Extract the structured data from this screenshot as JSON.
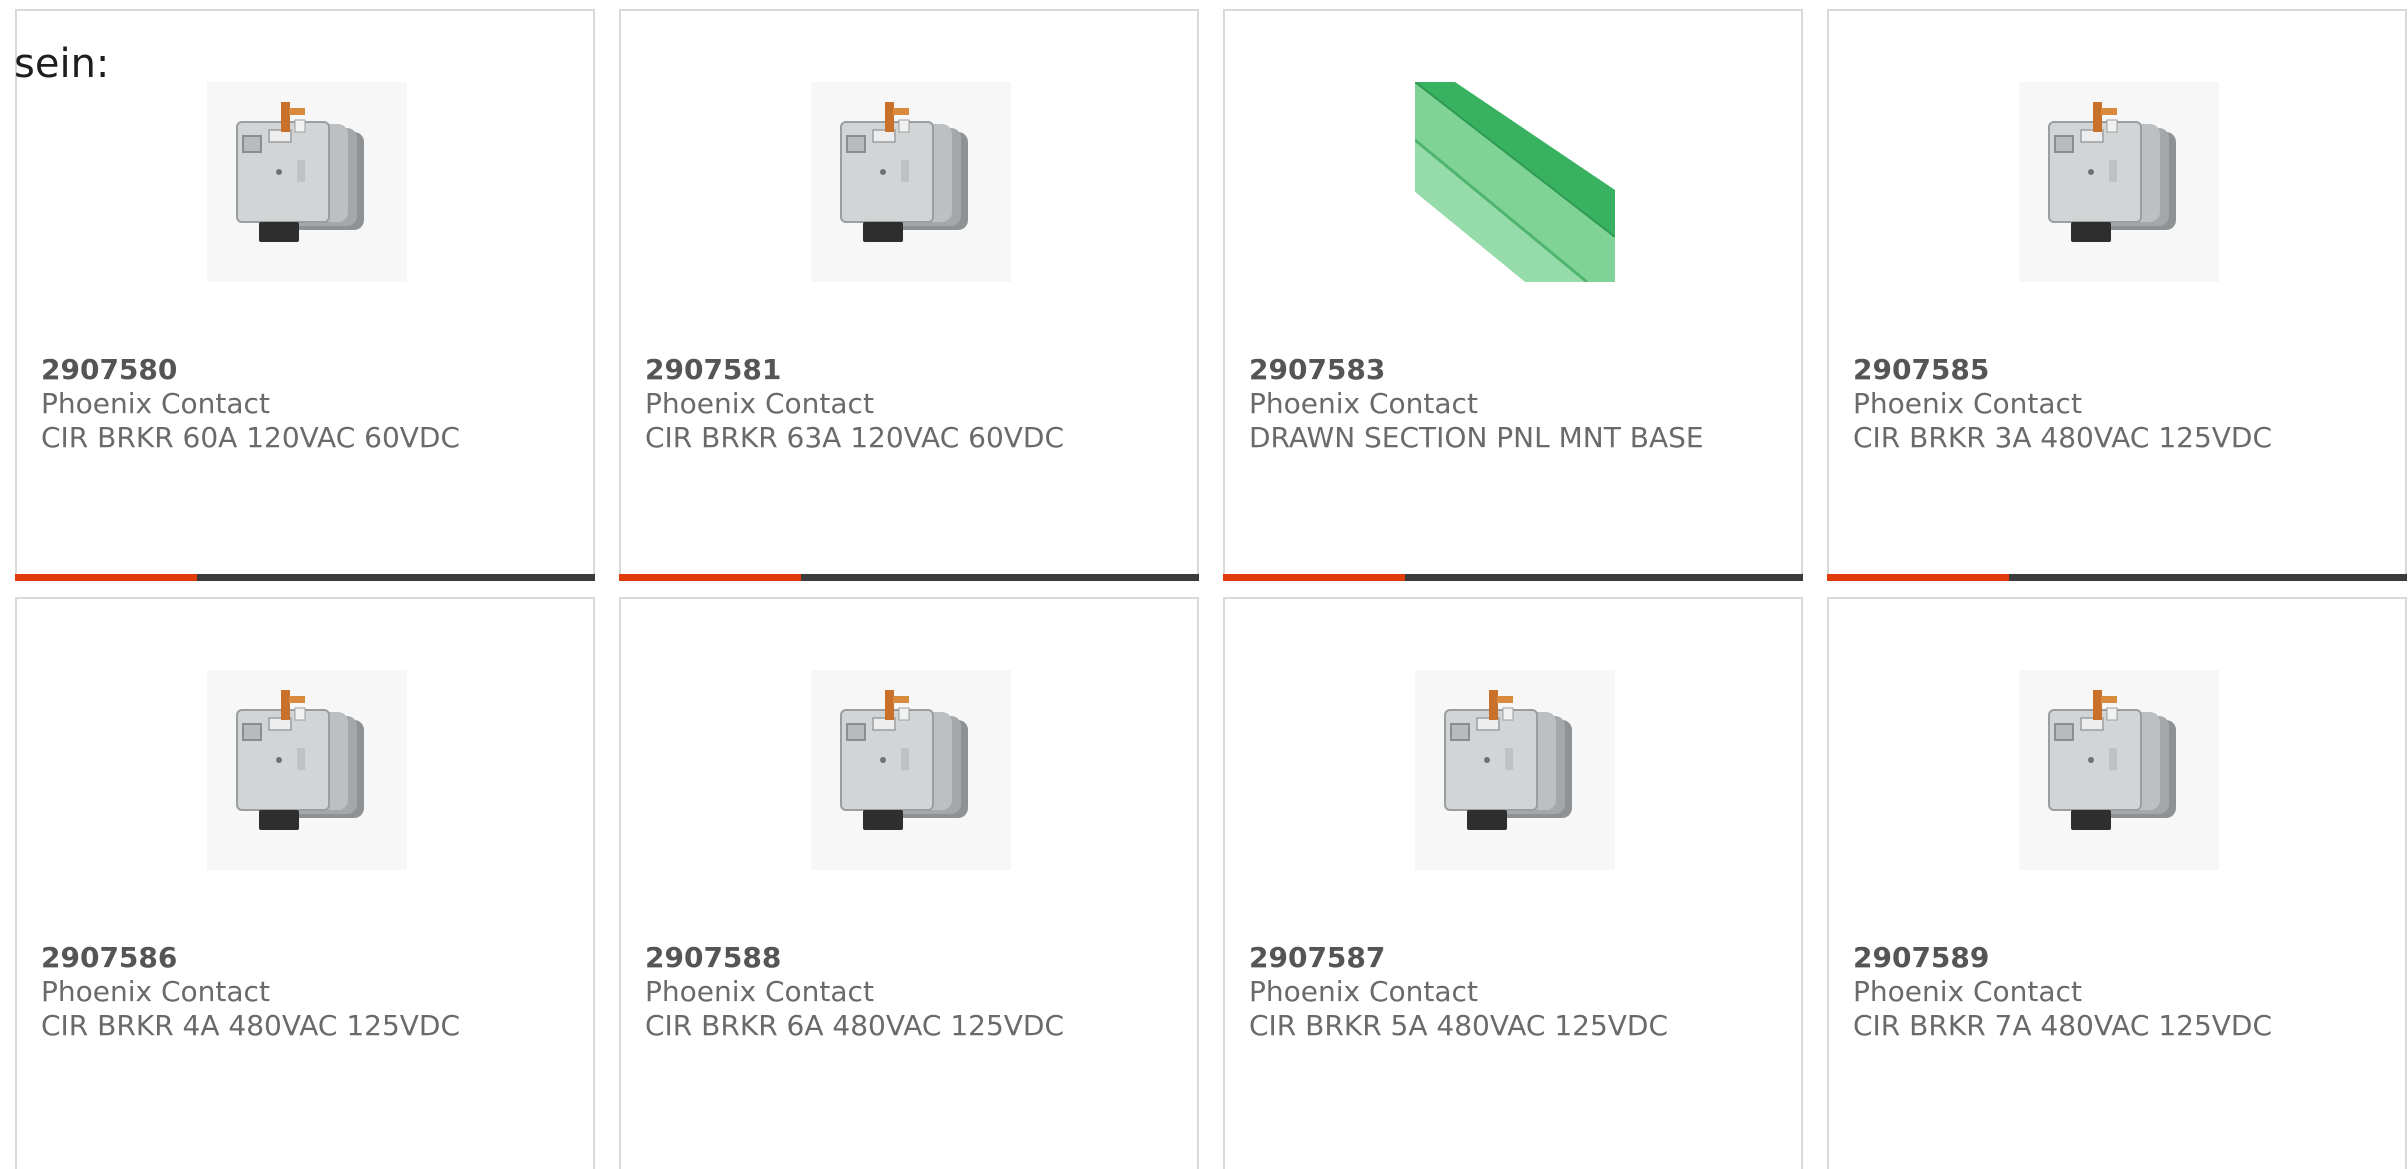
{
  "lead_text": "sein:",
  "colors": {
    "accent": "#e13a0b",
    "bar": "#3b3b3b",
    "border": "#d9d9d9"
  },
  "products": [
    {
      "part_number": "2907580",
      "brand": "Phoenix Contact",
      "description": "CIR BRKR 60A 120VAC 60VDC",
      "image": "circuit-breaker"
    },
    {
      "part_number": "2907581",
      "brand": "Phoenix Contact",
      "description": "CIR BRKR 63A 120VAC 60VDC",
      "image": "circuit-breaker"
    },
    {
      "part_number": "2907583",
      "brand": "Phoenix Contact",
      "description": "DRAWN SECTION PNL MNT BASE",
      "image": "green-rail"
    },
    {
      "part_number": "2907585",
      "brand": "Phoenix Contact",
      "description": "CIR BRKR 3A 480VAC 125VDC",
      "image": "circuit-breaker"
    },
    {
      "part_number": "2907586",
      "brand": "Phoenix Contact",
      "description": "CIR BRKR 4A 480VAC 125VDC",
      "image": "circuit-breaker"
    },
    {
      "part_number": "2907588",
      "brand": "Phoenix Contact",
      "description": "CIR BRKR 6A 480VAC 125VDC",
      "image": "circuit-breaker"
    },
    {
      "part_number": "2907587",
      "brand": "Phoenix Contact",
      "description": "CIR BRKR 5A 480VAC 125VDC",
      "image": "circuit-breaker"
    },
    {
      "part_number": "2907589",
      "brand": "Phoenix Contact",
      "description": "CIR BRKR 7A 480VAC 125VDC",
      "image": "circuit-breaker"
    }
  ]
}
